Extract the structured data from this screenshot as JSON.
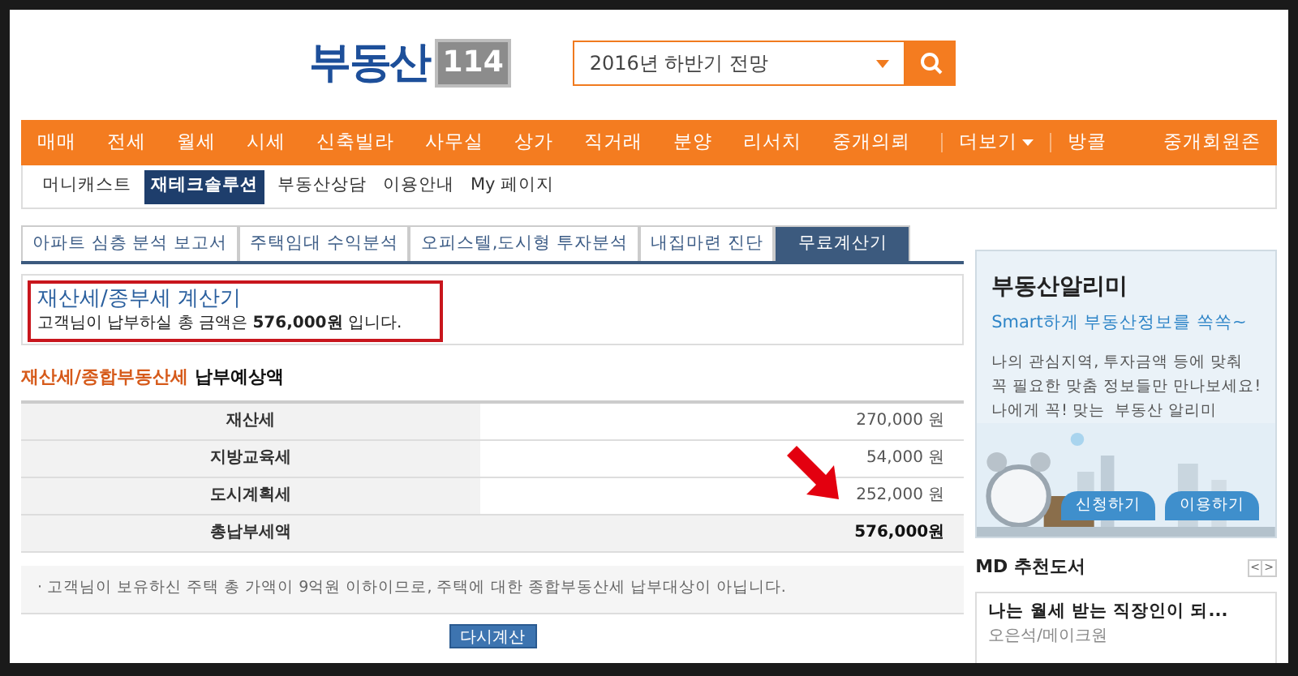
{
  "logo": {
    "text": "부동산",
    "badge": "114"
  },
  "search": {
    "value": "2016년 하반기 전망"
  },
  "main_nav": [
    {
      "label": "매매"
    },
    {
      "label": "전세"
    },
    {
      "label": "월세"
    },
    {
      "label": "시세"
    },
    {
      "label": "신축빌라"
    },
    {
      "label": "사무실"
    },
    {
      "label": "상가"
    },
    {
      "label": "직거래"
    },
    {
      "label": "분양"
    },
    {
      "label": "리서치"
    },
    {
      "label": "중개의뢰"
    },
    {
      "label": "더보기",
      "dropdown": true
    },
    {
      "label": "방콜"
    }
  ],
  "main_nav_right": "중개회원존",
  "sub_nav": [
    {
      "label": "머니캐스트",
      "selected": false
    },
    {
      "label": "재테크솔루션",
      "selected": true
    },
    {
      "label": "부동산상담",
      "selected": false
    },
    {
      "label": "이용안내",
      "selected": false
    },
    {
      "label": "My 페이지",
      "selected": false
    }
  ],
  "tabs": [
    {
      "label": "아파트 심층 분석 보고서",
      "selected": false
    },
    {
      "label": "주택임대 수익분석",
      "selected": false
    },
    {
      "label": "오피스텔,도시형 투자분석",
      "selected": false
    },
    {
      "label": "내집마련 진단",
      "selected": false
    },
    {
      "label": "무료계산기",
      "selected": true
    }
  ],
  "result_box": {
    "title": "재산세/종부세 계산기",
    "message": "고객님이 납부하실 총 금액은 **576,000원** 입니다."
  },
  "section_title": {
    "highlight": "재산세/종합부동산세",
    "rest": "납부예상액"
  },
  "table": {
    "rows": [
      {
        "kind": "item",
        "label": "재산세",
        "value": "270,000 원"
      },
      {
        "kind": "item",
        "label": "지방교육세",
        "value": "54,000 원"
      },
      {
        "kind": "item",
        "label": "도시계획세",
        "value": "252,000 원"
      },
      {
        "kind": "total",
        "label": "총납부세액",
        "value": "576,000원"
      }
    ]
  },
  "note": "· 고객님이 보유하신 주택 총 가액이 9억원 이하이므로, 주택에 대한 종합부동산세 납부대상이 아닙니다.",
  "recalc_button": "다시계산",
  "ad": {
    "title": "부동산알리미",
    "subtitle": "Smart하게 부동산정보를 쏙쏙~",
    "lines": [
      "나의 관심지역, 투자금액 등에 맞춰",
      "꼭 필요한 맞춤 정보들만 만나보세요!",
      "나에게 꼭! 맞는  부동산 알리미"
    ],
    "buttons": [
      "신청하기",
      "이용하기"
    ]
  },
  "books": {
    "title": "MD 추천도서",
    "prev": "<",
    "next": ">",
    "book_title": "나는 월세 받는 직장인이 되...",
    "author": "오은석/메이크원"
  }
}
